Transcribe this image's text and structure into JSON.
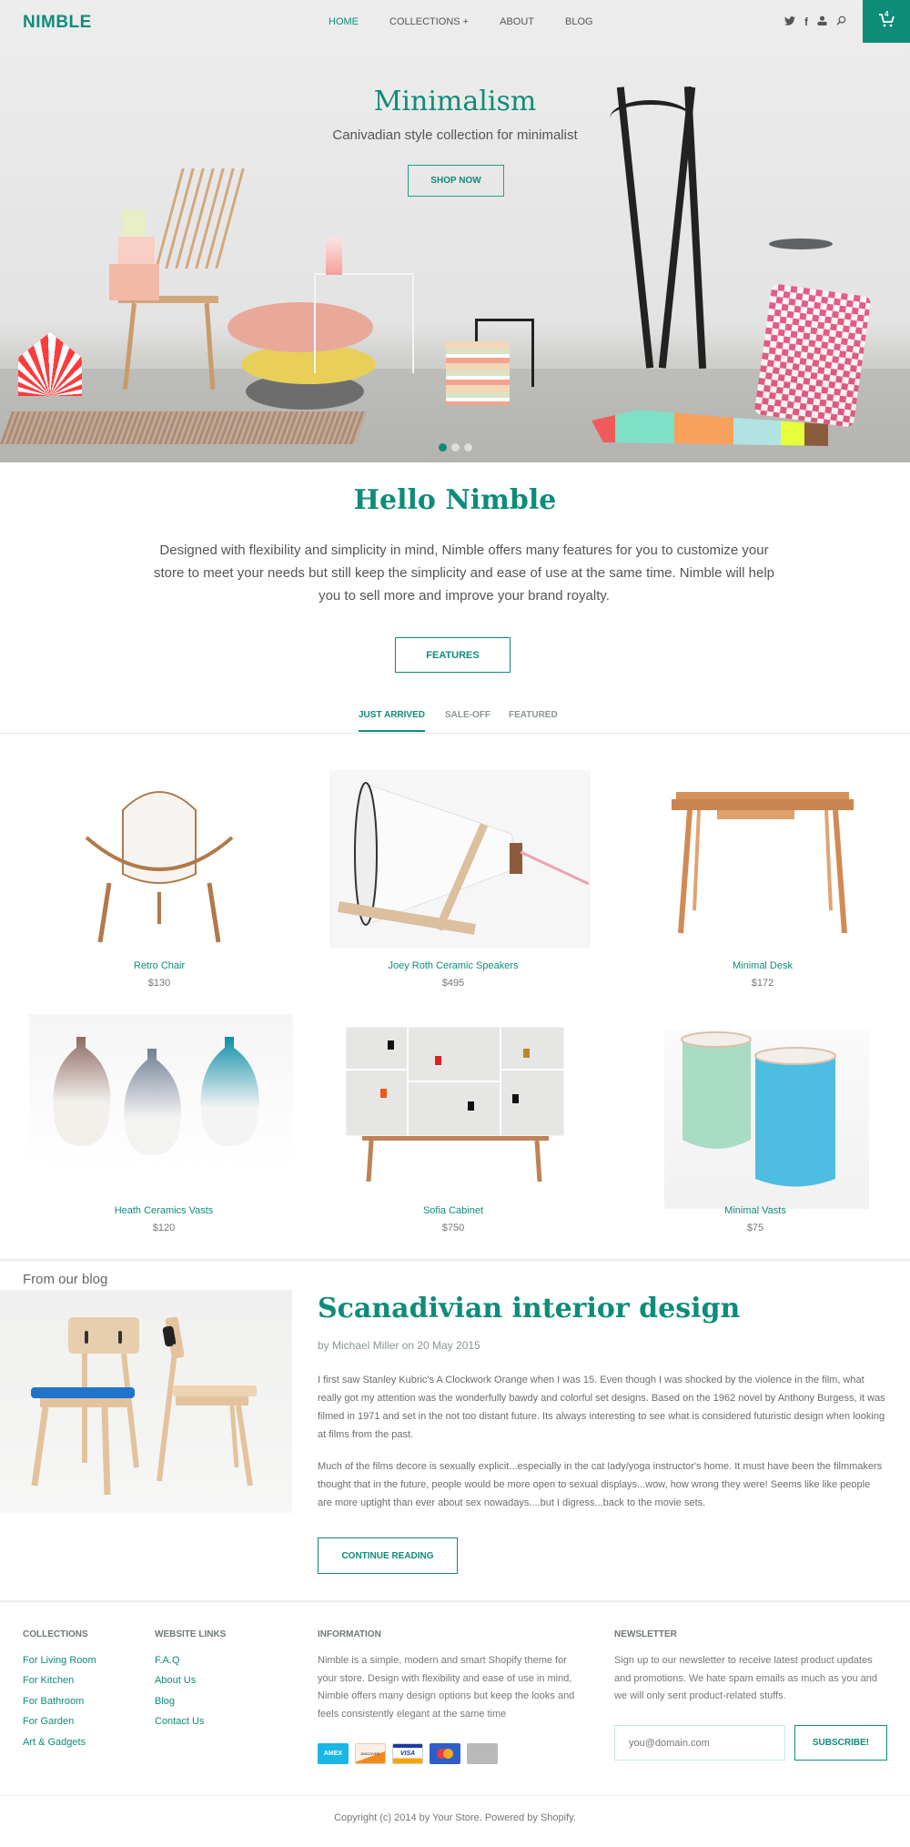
{
  "header": {
    "logo": "NIMBLE",
    "nav": [
      {
        "label": "HOME",
        "active": true
      },
      {
        "label": "COLLECTIONS +",
        "active": false
      },
      {
        "label": "ABOUT",
        "active": false
      },
      {
        "label": "BLOG",
        "active": false
      }
    ],
    "icons": [
      "twitter-icon",
      "facebook-icon",
      "user-icon",
      "search-icon"
    ],
    "cart_count": "4"
  },
  "hero": {
    "title": "Minimalism",
    "subtitle": "Canivadian style collection for minimalist",
    "button": "SHOP NOW",
    "slides": 3,
    "active_slide": 1
  },
  "intro": {
    "title": "Hello Nimble",
    "text": "Designed with flexibility and simplicity in mind, Nimble offers many features for you to customize your store to meet your needs but still keep the simplicity and ease of use at the same time. Nimble will help you to sell more and improve your brand royalty.",
    "button": "FEATURES"
  },
  "tabs": [
    {
      "label": "JUST ARRIVED",
      "active": true
    },
    {
      "label": "SALE-OFF",
      "active": false
    },
    {
      "label": "FEATURED",
      "active": false
    }
  ],
  "products": [
    {
      "name": "Retro Chair",
      "price": "$130"
    },
    {
      "name": "Joey Roth Ceramic Speakers",
      "price": "$495"
    },
    {
      "name": "Minimal Desk",
      "price": "$172"
    },
    {
      "name": "Heath Ceramics Vasts",
      "price": "$120"
    },
    {
      "name": "Sofia Cabinet",
      "price": "$750"
    },
    {
      "name": "Minimal Vasts",
      "price": "$75"
    }
  ],
  "blog": {
    "section_label": "From our blog",
    "title": "Scanadivian interior design",
    "meta": "by Michael Miller on 20 May 2015",
    "paragraphs": [
      "I first saw Stanley Kubric's A Clockwork Orange when I was 15. Even though I was shocked by the violence in the film, what really got my attention was the wonderfully bawdy and colorful set designs. Based on the 1962 novel by Anthony Burgess, it was filmed in 1971 and set in the not too distant future. Its always interesting to see what is considered futuristic design when looking at films from the past.",
      "Much of the films decore is sexually explicit...especially in the cat lady/yoga instructor's home. It must have been the filmmakers thought that in the future, people would be more open to sexual displays...wow, how wrong they were! Seems like like people are more uptight than ever about sex nowadays....but I digress...back to the movie sets."
    ],
    "button": "CONTINUE READING"
  },
  "footer": {
    "collections": {
      "heading": "COLLECTIONS",
      "links": [
        "For Living Room",
        "For Kitchen",
        "For Bathroom",
        "For Garden",
        "Art & Gadgets"
      ]
    },
    "website_links": {
      "heading": "WEBSITE LINKS",
      "links": [
        "F.A.Q",
        "About Us",
        "Blog",
        "Contact Us"
      ]
    },
    "information": {
      "heading": "INFORMATION",
      "text": "Nimble is a simple, modern and smart Shopify theme for your store. Design with flexibility and ease of use in mind, Nimble offers many design options but keep the looks and feels consistently elegant at the same time",
      "cards": [
        "AMEX",
        "DISCOVER",
        "VISA",
        "MASTERCARD",
        "GENERIC CARD"
      ]
    },
    "newsletter": {
      "heading": "NEWSLETTER",
      "text": "Sign up to our newsletter to receive latest product updates and promotions. We hate spam emails as much as you and we will only sent product-related stuffs.",
      "placeholder": "you@domain.com",
      "button": "SUBSCRIBE!"
    },
    "copyright": "Copyright (c) 2014 by Your Store. Powered by Shopify."
  },
  "colors": {
    "accent": "#0e8c7a",
    "text": "#666666",
    "muted": "#8a9594"
  }
}
